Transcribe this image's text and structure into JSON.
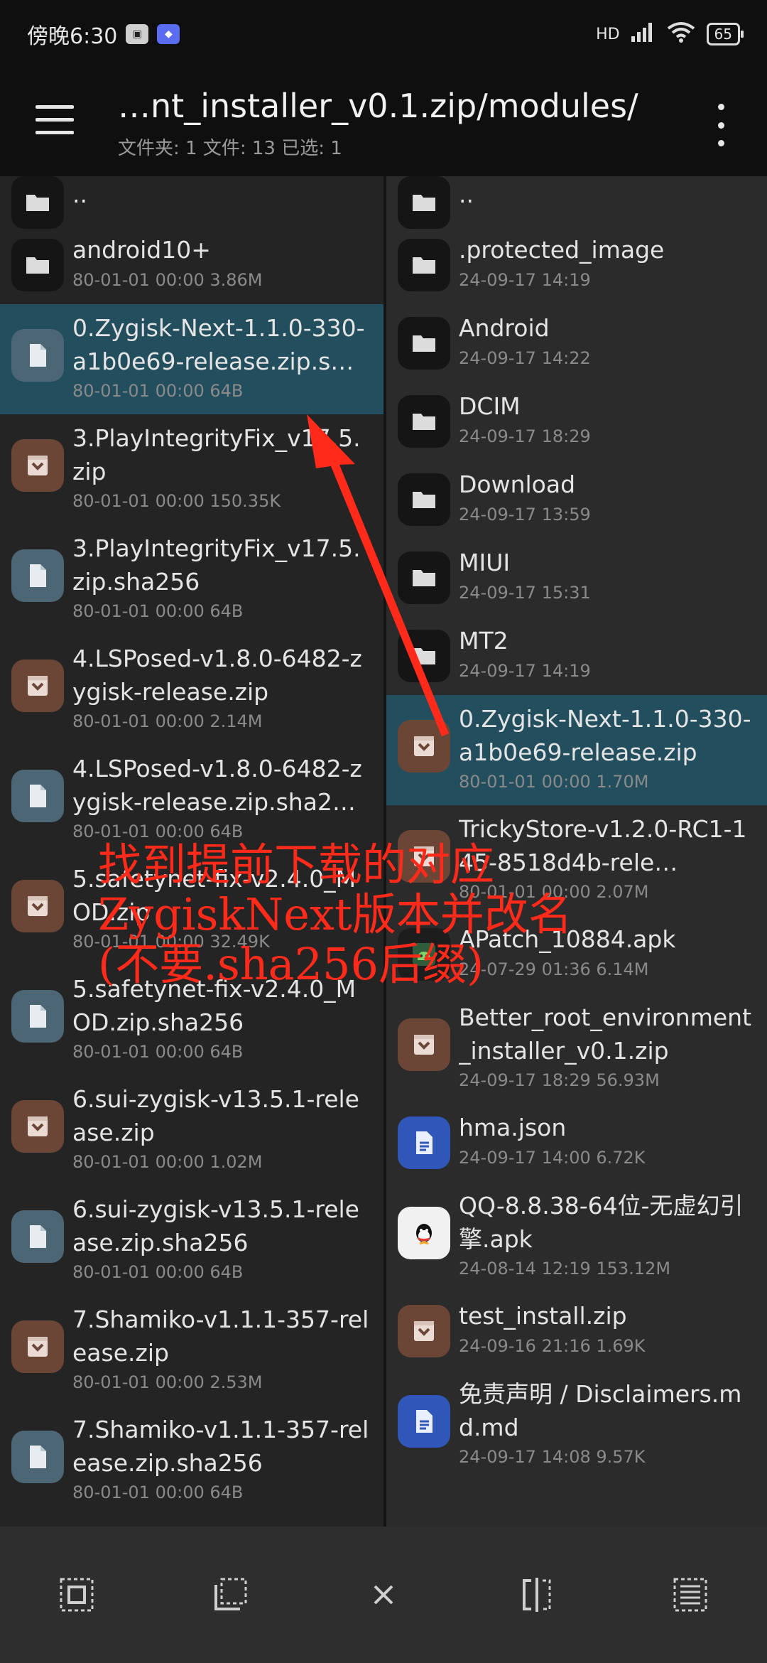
{
  "status_bar": {
    "time": "傍晚6:30",
    "network": "HD",
    "battery": "65"
  },
  "toolbar": {
    "title": "…nt_installer_v0.1.zip/modules/",
    "subtitle": "文件夹: 1  文件: 13  已选: 1"
  },
  "left_pane": {
    "items": [
      {
        "name": "..",
        "meta": "",
        "type": "folder",
        "selected": false
      },
      {
        "name": "android10+",
        "meta": "80-01-01 00:00  3.86M",
        "type": "folder",
        "selected": false
      },
      {
        "name": "0.Zygisk-Next-1.1.0-330-a1b0e69-release.zip.s…",
        "meta": "80-01-01 00:00  64B",
        "type": "file",
        "selected": true
      },
      {
        "name": "3.PlayIntegrityFix_v17.5.zip",
        "meta": "80-01-01 00:00  150.35K",
        "type": "archive",
        "selected": false
      },
      {
        "name": "3.PlayIntegrityFix_v17.5.zip.sha256",
        "meta": "80-01-01 00:00  64B",
        "type": "file",
        "selected": false
      },
      {
        "name": "4.LSPosed-v1.8.0-6482-zygisk-release.zip",
        "meta": "80-01-01 00:00  2.14M",
        "type": "archive",
        "selected": false
      },
      {
        "name": "4.LSPosed-v1.8.0-6482-zygisk-release.zip.sha2…",
        "meta": "80-01-01 00:00  64B",
        "type": "file",
        "selected": false
      },
      {
        "name": "5.safetynet-fix-v2.4.0_MOD.zip",
        "meta": "80-01-01 00:00  32.49K",
        "type": "archive",
        "selected": false
      },
      {
        "name": "5.safetynet-fix-v2.4.0_MOD.zip.sha256",
        "meta": "80-01-01 00:00  64B",
        "type": "file",
        "selected": false
      },
      {
        "name": "6.sui-zygisk-v13.5.1-release.zip",
        "meta": "80-01-01 00:00  1.02M",
        "type": "archive",
        "selected": false
      },
      {
        "name": "6.sui-zygisk-v13.5.1-release.zip.sha256",
        "meta": "80-01-01 00:00  64B",
        "type": "file",
        "selected": false
      },
      {
        "name": "7.Shamiko-v1.1.1-357-release.zip",
        "meta": "80-01-01 00:00  2.53M",
        "type": "archive",
        "selected": false
      },
      {
        "name": "7.Shamiko-v1.1.1-357-release.zip.sha256",
        "meta": "80-01-01 00:00  64B",
        "type": "file",
        "selected": false
      }
    ]
  },
  "right_pane": {
    "items": [
      {
        "name": "..",
        "meta": "",
        "type": "folder",
        "selected": false
      },
      {
        "name": ".protected_image",
        "meta": "24-09-17 14:19",
        "type": "folder",
        "selected": false
      },
      {
        "name": "Android",
        "meta": "24-09-17 14:22",
        "type": "folder",
        "selected": false
      },
      {
        "name": "DCIM",
        "meta": "24-09-17 18:29",
        "type": "folder",
        "selected": false
      },
      {
        "name": "Download",
        "meta": "24-09-17 13:59",
        "type": "folder",
        "selected": false
      },
      {
        "name": "MIUI",
        "meta": "24-09-17 15:31",
        "type": "folder",
        "selected": false
      },
      {
        "name": "MT2",
        "meta": "24-09-17 14:19",
        "type": "folder",
        "selected": false
      },
      {
        "name": "0.Zygisk-Next-1.1.0-330-a1b0e69-release.zip",
        "meta": "80-01-01 00:00  1.70M",
        "type": "archive",
        "selected": true
      },
      {
        "name": "TrickyStore-v1.2.0-RC1-145-8518d4b-rele…",
        "meta": "80-01-01 00:00  2.07M",
        "type": "archive",
        "selected": false
      },
      {
        "name": "APatch_10884.apk",
        "meta": "24-07-29 01:36  6.14M",
        "type": "apk",
        "selected": false
      },
      {
        "name": "Better_root_environment_installer_v0.1.zip",
        "meta": "24-09-17 18:29  56.93M",
        "type": "archive",
        "selected": false
      },
      {
        "name": "hma.json",
        "meta": "24-09-17 14:00  6.72K",
        "type": "doc",
        "selected": false
      },
      {
        "name": "QQ-8.8.38-64位-无虚幻引擎.apk",
        "meta": "24-08-14 12:19  153.12M",
        "type": "qq",
        "selected": false
      },
      {
        "name": "test_install.zip",
        "meta": "24-09-16 21:16  1.69K",
        "type": "archive",
        "selected": false
      },
      {
        "name": "免责声明 / Disclaimers.md.md",
        "meta": "24-09-17 14:08  9.57K",
        "type": "doc",
        "selected": false
      }
    ]
  },
  "annotation": {
    "line1": "找到提前下载的对应",
    "line2": "ZygiskNext版本并改名",
    "line3": "(不要.sha256后缀)",
    "color": "#ff2a1a"
  },
  "bottom_bar": {
    "icons": [
      "select-all-icon",
      "select-range-icon",
      "close-icon",
      "split-view-icon",
      "list-select-icon"
    ]
  },
  "colors": {
    "toolbar_bg": "#0f0f0f",
    "selected_bg": "#234e5e",
    "folder_icon_bg": "#151515",
    "file_icon_bg": "#4d6676",
    "archive_icon_bg": "#6b4637",
    "doc_icon_bg": "#2f56b8"
  }
}
